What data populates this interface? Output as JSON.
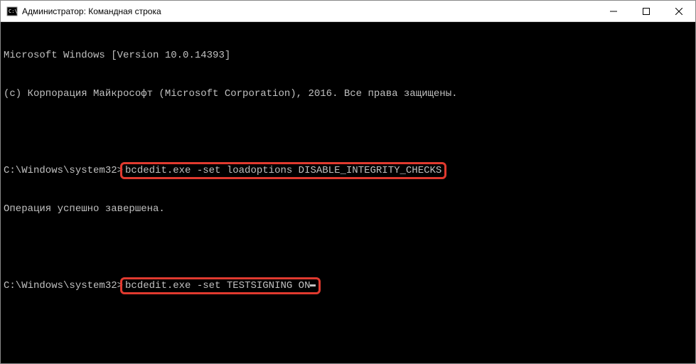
{
  "window": {
    "title": "Администратор: Командная строка"
  },
  "terminal": {
    "line0": "Microsoft Windows [Version 10.0.14393]",
    "line1": "(c) Корпорация Майкрософт (Microsoft Corporation), 2016. Все права защищены.",
    "prompt0": "C:\\Windows\\system32>",
    "cmd0": "bcdedit.exe -set loadoptions DISABLE_INTEGRITY_CHECKS",
    "result0": "Операция успешно завершена.",
    "prompt1": "C:\\Windows\\system32>",
    "cmd1": "bcdedit.exe -set TESTSIGNING ON"
  }
}
